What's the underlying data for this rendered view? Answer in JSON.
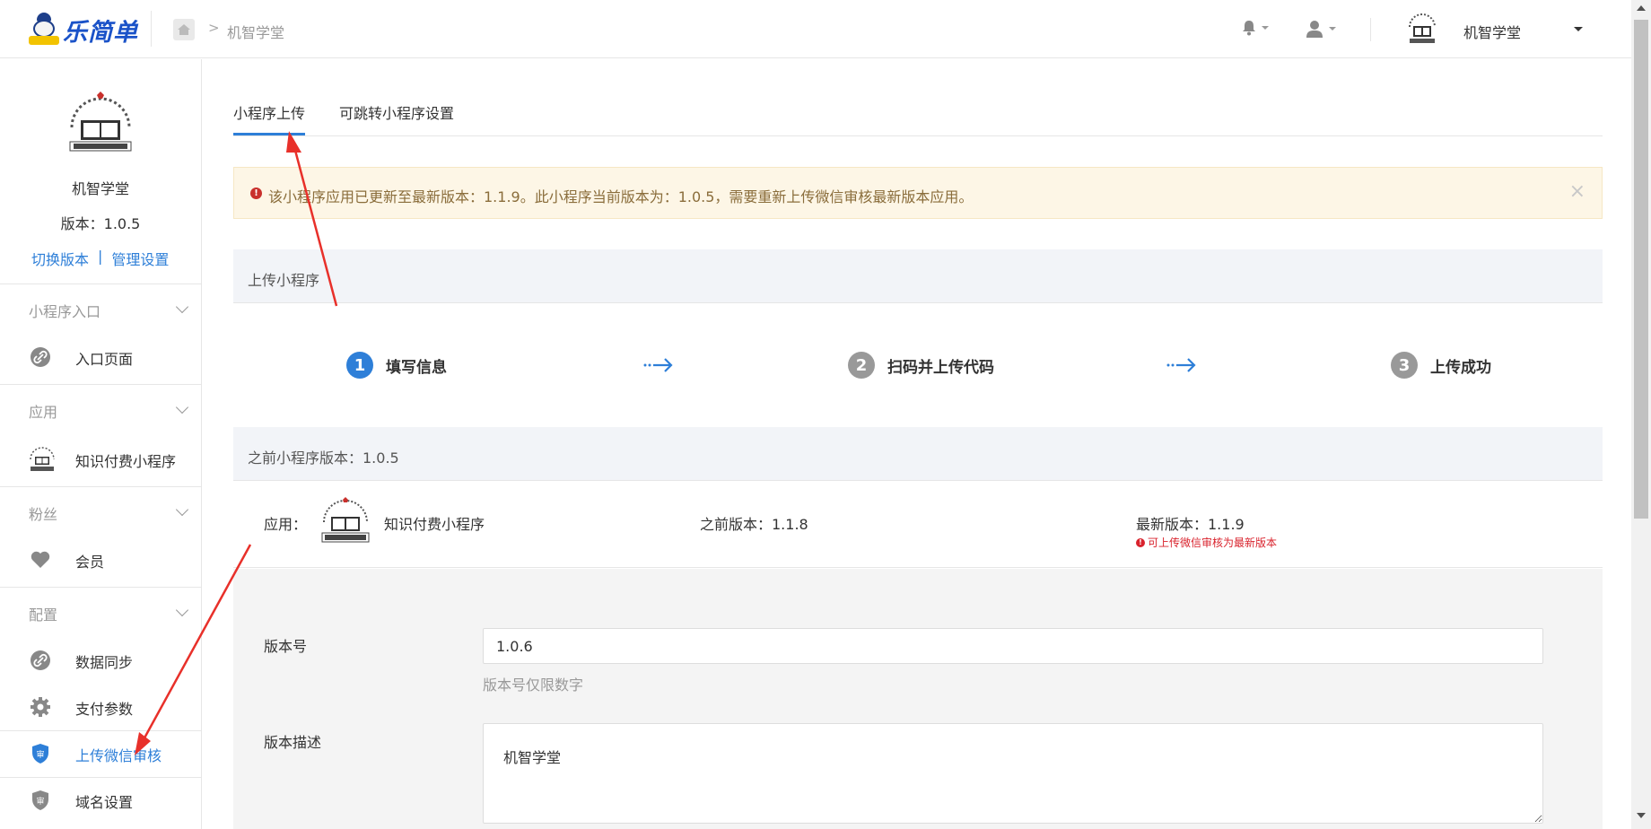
{
  "topbar": {
    "brand": "乐简单",
    "breadcrumb": "机智学堂",
    "account_name": "机智学堂"
  },
  "sidebar": {
    "shop_name": "机智学堂",
    "version_text": "版本：1.0.5",
    "switch_version": "切换版本",
    "link_sep": "|",
    "manage_settings": "管理设置",
    "groups": [
      {
        "label": "小程序入口",
        "items": [
          {
            "label": "入口页面",
            "icon": "link-icon"
          }
        ]
      },
      {
        "label": "应用",
        "items": [
          {
            "label": "知识付费小程序",
            "icon": "app-logo-icon"
          }
        ]
      },
      {
        "label": "粉丝",
        "items": [
          {
            "label": "会员",
            "icon": "heart-icon"
          }
        ]
      },
      {
        "label": "配置",
        "items": [
          {
            "label": "数据同步",
            "icon": "link-icon"
          },
          {
            "label": "支付参数",
            "icon": "gear-icon"
          },
          {
            "label": "上传微信审核",
            "icon": "shield-icon",
            "active": true
          },
          {
            "label": "域名设置",
            "icon": "shield-icon"
          }
        ]
      }
    ]
  },
  "tabs": [
    {
      "label": "小程序上传",
      "active": true
    },
    {
      "label": "可跳转小程序设置",
      "active": false
    }
  ],
  "alert": {
    "text": "该小程序应用已更新至最新版本：1.1.9。此小程序当前版本为：1.0.5，需要重新上传微信审核最新版本应用。",
    "close": "×"
  },
  "upload_panel": {
    "title": "上传小程序",
    "steps": [
      {
        "num": "1",
        "label": "填写信息",
        "active": true
      },
      {
        "num": "2",
        "label": "扫码并上传代码",
        "active": false
      },
      {
        "num": "3",
        "label": "上传成功",
        "active": false
      }
    ]
  },
  "previous_panel": {
    "title": "之前小程序版本：1.0.5",
    "app_label": "应用：",
    "app_name": "知识付费小程序",
    "prev_version": "之前版本：1.1.8",
    "latest_version": "最新版本：1.1.9",
    "latest_note": "可上传微信审核为最新版本"
  },
  "form": {
    "version_label": "版本号",
    "version_value": "1.0.6",
    "version_help": "版本号仅限数字",
    "desc_label": "版本描述",
    "desc_value": "机智学堂"
  },
  "colors": {
    "accent": "#2e7fd8",
    "alert_bg": "#fdf6e6",
    "alert_text": "#8a6d3b",
    "danger": "#d9232d",
    "annotation": "#e8302a"
  }
}
